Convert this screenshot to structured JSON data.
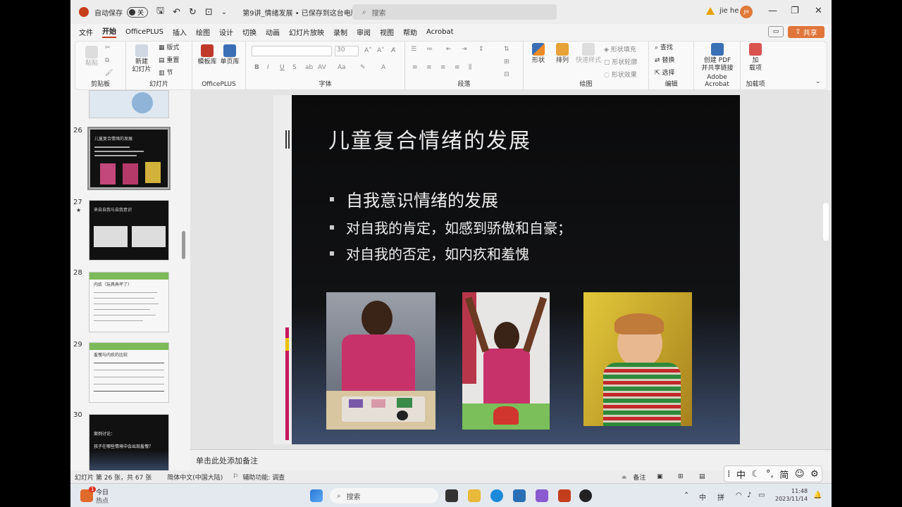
{
  "titlebar": {
    "autosave_label": "自动保存",
    "autosave_state": "关",
    "doc_title": "第9讲_情绪发展 • 已保存到这台电脑 ⌄",
    "search_placeholder": "搜索",
    "user_name": "jie he",
    "user_initials": "JH"
  },
  "tabs": [
    "文件",
    "开始",
    "OfficePLUS",
    "插入",
    "绘图",
    "设计",
    "切换",
    "动画",
    "幻灯片放映",
    "录制",
    "审阅",
    "视图",
    "帮助",
    "Acrobat"
  ],
  "share_label": "共享",
  "ribbon": {
    "clipboard": {
      "paste": "粘贴",
      "label": "剪贴板"
    },
    "slides": {
      "new_slide": "新建\n幻灯片",
      "layout": "版式",
      "reset": "重置",
      "section": "节",
      "label": "幻灯片"
    },
    "officeplus": {
      "template": "模板库",
      "single": "单页库",
      "label": "OfficePLUS"
    },
    "font": {
      "size": "30",
      "label": "字体"
    },
    "paragraph": {
      "label": "段落"
    },
    "drawing": {
      "shapes": "形状",
      "arrange": "排列",
      "quickstyle": "快速样式",
      "fill": "形状填充",
      "outline": "形状轮廓",
      "effect": "形状效果",
      "label": "绘图"
    },
    "editing": {
      "find": "查找",
      "replace": "替换",
      "select": "选择",
      "label": "编辑"
    },
    "acrobat": {
      "create": "创建 PDF\n并共享链接",
      "label": "Adobe Acrobat"
    },
    "addins": {
      "addin": "加\n载项",
      "label": "加载项"
    }
  },
  "thumbnails": [
    {
      "num": "26",
      "title": "儿童复合情绪的发展"
    },
    {
      "num": "27",
      "title": "来自自我与自我意识"
    },
    {
      "num": "28",
      "title": "内疚（玩具弄坏了）"
    },
    {
      "num": "29",
      "title": "羞愧与内疚的比较"
    },
    {
      "num": "30",
      "title": "案例讨论：",
      "subtitle": "孩子在哪些情境中会出现羞愧？"
    }
  ],
  "slide": {
    "title": "儿童复合情绪的发展",
    "bullets": [
      "自我意识情绪的发展",
      "对自我的肯定，如感到骄傲和自豪；",
      "对自我的否定，如内疚和羞愧"
    ]
  },
  "notes_placeholder": "单击此处添加备注",
  "status": {
    "slide_info": "幻灯片 第 26 张，共 67 张",
    "language": "简体中文(中国大陆)",
    "accessibility": "辅助功能: 调查",
    "notes_btn": "备注"
  },
  "ime": {
    "mode": "中",
    "simp": "简"
  },
  "taskbar": {
    "weather_label": "今日",
    "weather_sub": "热点",
    "badge": "1",
    "search_placeholder": "搜索",
    "tray_lang": "中",
    "tray_ime": "拼",
    "time": "11:48",
    "date": "2023/11/14"
  },
  "colors": {
    "accent": "#c43e1c",
    "share": "#e0763a"
  }
}
